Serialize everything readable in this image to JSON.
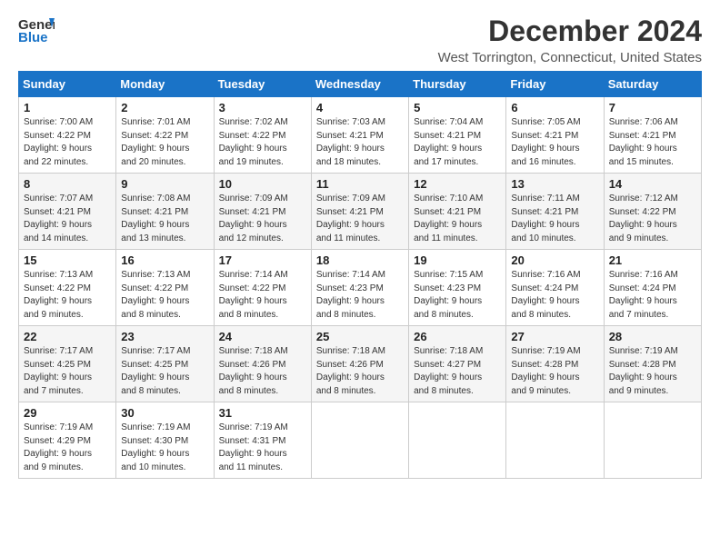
{
  "header": {
    "logo_line1": "General",
    "logo_line2": "Blue",
    "title": "December 2024",
    "subtitle": "West Torrington, Connecticut, United States"
  },
  "weekdays": [
    "Sunday",
    "Monday",
    "Tuesday",
    "Wednesday",
    "Thursday",
    "Friday",
    "Saturday"
  ],
  "weeks": [
    [
      {
        "day": "1",
        "info": "Sunrise: 7:00 AM\nSunset: 4:22 PM\nDaylight: 9 hours\nand 22 minutes."
      },
      {
        "day": "2",
        "info": "Sunrise: 7:01 AM\nSunset: 4:22 PM\nDaylight: 9 hours\nand 20 minutes."
      },
      {
        "day": "3",
        "info": "Sunrise: 7:02 AM\nSunset: 4:22 PM\nDaylight: 9 hours\nand 19 minutes."
      },
      {
        "day": "4",
        "info": "Sunrise: 7:03 AM\nSunset: 4:21 PM\nDaylight: 9 hours\nand 18 minutes."
      },
      {
        "day": "5",
        "info": "Sunrise: 7:04 AM\nSunset: 4:21 PM\nDaylight: 9 hours\nand 17 minutes."
      },
      {
        "day": "6",
        "info": "Sunrise: 7:05 AM\nSunset: 4:21 PM\nDaylight: 9 hours\nand 16 minutes."
      },
      {
        "day": "7",
        "info": "Sunrise: 7:06 AM\nSunset: 4:21 PM\nDaylight: 9 hours\nand 15 minutes."
      }
    ],
    [
      {
        "day": "8",
        "info": "Sunrise: 7:07 AM\nSunset: 4:21 PM\nDaylight: 9 hours\nand 14 minutes."
      },
      {
        "day": "9",
        "info": "Sunrise: 7:08 AM\nSunset: 4:21 PM\nDaylight: 9 hours\nand 13 minutes."
      },
      {
        "day": "10",
        "info": "Sunrise: 7:09 AM\nSunset: 4:21 PM\nDaylight: 9 hours\nand 12 minutes."
      },
      {
        "day": "11",
        "info": "Sunrise: 7:09 AM\nSunset: 4:21 PM\nDaylight: 9 hours\nand 11 minutes."
      },
      {
        "day": "12",
        "info": "Sunrise: 7:10 AM\nSunset: 4:21 PM\nDaylight: 9 hours\nand 11 minutes."
      },
      {
        "day": "13",
        "info": "Sunrise: 7:11 AM\nSunset: 4:21 PM\nDaylight: 9 hours\nand 10 minutes."
      },
      {
        "day": "14",
        "info": "Sunrise: 7:12 AM\nSunset: 4:22 PM\nDaylight: 9 hours\nand 9 minutes."
      }
    ],
    [
      {
        "day": "15",
        "info": "Sunrise: 7:13 AM\nSunset: 4:22 PM\nDaylight: 9 hours\nand 9 minutes."
      },
      {
        "day": "16",
        "info": "Sunrise: 7:13 AM\nSunset: 4:22 PM\nDaylight: 9 hours\nand 8 minutes."
      },
      {
        "day": "17",
        "info": "Sunrise: 7:14 AM\nSunset: 4:22 PM\nDaylight: 9 hours\nand 8 minutes."
      },
      {
        "day": "18",
        "info": "Sunrise: 7:14 AM\nSunset: 4:23 PM\nDaylight: 9 hours\nand 8 minutes."
      },
      {
        "day": "19",
        "info": "Sunrise: 7:15 AM\nSunset: 4:23 PM\nDaylight: 9 hours\nand 8 minutes."
      },
      {
        "day": "20",
        "info": "Sunrise: 7:16 AM\nSunset: 4:24 PM\nDaylight: 9 hours\nand 8 minutes."
      },
      {
        "day": "21",
        "info": "Sunrise: 7:16 AM\nSunset: 4:24 PM\nDaylight: 9 hours\nand 7 minutes."
      }
    ],
    [
      {
        "day": "22",
        "info": "Sunrise: 7:17 AM\nSunset: 4:25 PM\nDaylight: 9 hours\nand 7 minutes."
      },
      {
        "day": "23",
        "info": "Sunrise: 7:17 AM\nSunset: 4:25 PM\nDaylight: 9 hours\nand 8 minutes."
      },
      {
        "day": "24",
        "info": "Sunrise: 7:18 AM\nSunset: 4:26 PM\nDaylight: 9 hours\nand 8 minutes."
      },
      {
        "day": "25",
        "info": "Sunrise: 7:18 AM\nSunset: 4:26 PM\nDaylight: 9 hours\nand 8 minutes."
      },
      {
        "day": "26",
        "info": "Sunrise: 7:18 AM\nSunset: 4:27 PM\nDaylight: 9 hours\nand 8 minutes."
      },
      {
        "day": "27",
        "info": "Sunrise: 7:19 AM\nSunset: 4:28 PM\nDaylight: 9 hours\nand 9 minutes."
      },
      {
        "day": "28",
        "info": "Sunrise: 7:19 AM\nSunset: 4:28 PM\nDaylight: 9 hours\nand 9 minutes."
      }
    ],
    [
      {
        "day": "29",
        "info": "Sunrise: 7:19 AM\nSunset: 4:29 PM\nDaylight: 9 hours\nand 9 minutes."
      },
      {
        "day": "30",
        "info": "Sunrise: 7:19 AM\nSunset: 4:30 PM\nDaylight: 9 hours\nand 10 minutes."
      },
      {
        "day": "31",
        "info": "Sunrise: 7:19 AM\nSunset: 4:31 PM\nDaylight: 9 hours\nand 11 minutes."
      },
      null,
      null,
      null,
      null
    ]
  ]
}
